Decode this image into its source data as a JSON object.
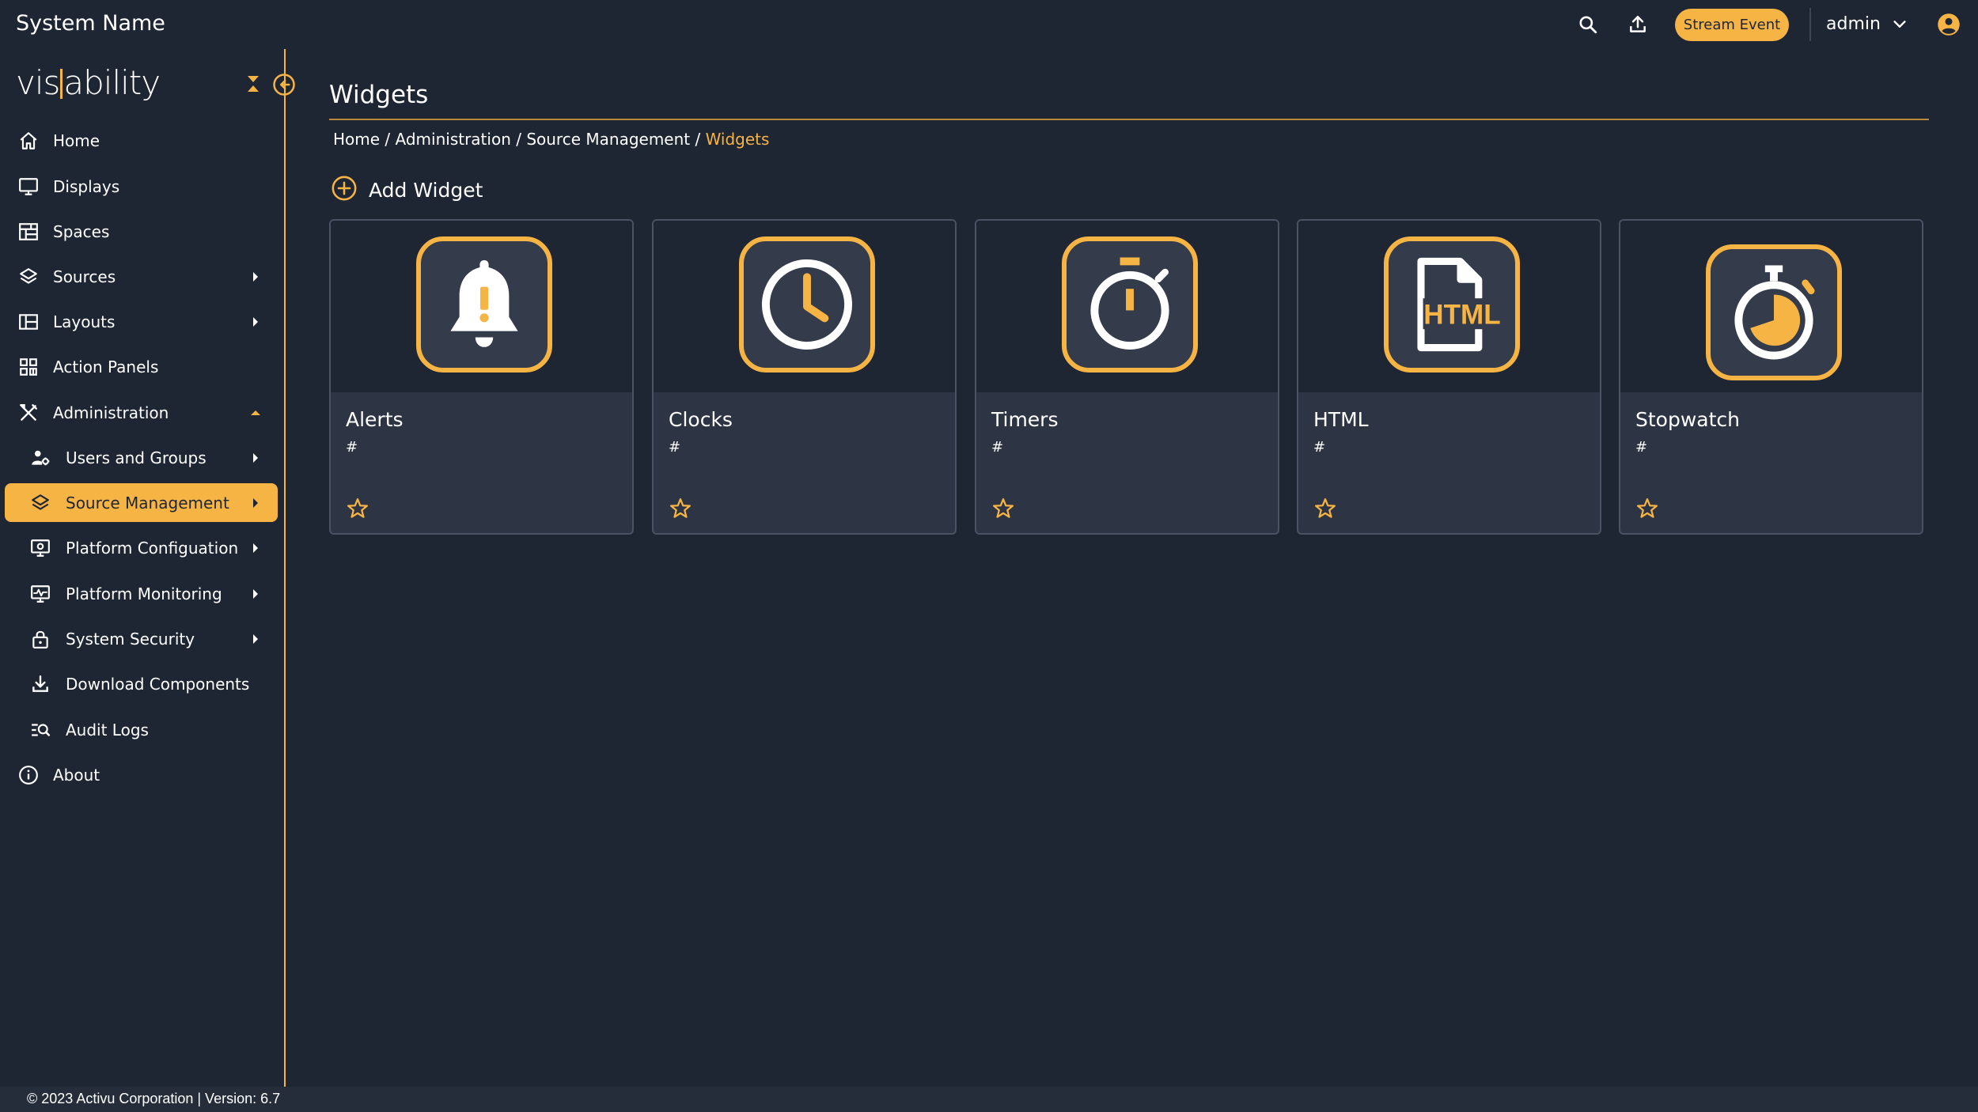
{
  "header": {
    "app_title": "System Name",
    "stream_event_label": "Stream Event",
    "user_name": "admin",
    "icons": [
      "search-icon",
      "upload-icon",
      "chevron-down-icon",
      "account-icon"
    ]
  },
  "logo": {
    "left": "vis",
    "right": "ability"
  },
  "sidebar": {
    "items": [
      {
        "label": "Home",
        "icon": "home-icon"
      },
      {
        "label": "Displays",
        "icon": "monitor-icon"
      },
      {
        "label": "Spaces",
        "icon": "spaces-icon"
      },
      {
        "label": "Sources",
        "icon": "layers-icon"
      },
      {
        "label": "Layouts",
        "icon": "layout-icon"
      },
      {
        "label": "Action Panels",
        "icon": "grid-icon"
      },
      {
        "label": "Administration",
        "icon": "tools-icon"
      },
      {
        "label": "Users and Groups",
        "icon": "users-gear-icon"
      },
      {
        "label": "Source Management",
        "icon": "layers-icon"
      },
      {
        "label": "Platform Configuation",
        "icon": "monitor-gear-icon"
      },
      {
        "label": "Platform Monitoring",
        "icon": "monitor-pulse-icon"
      },
      {
        "label": "System Security",
        "icon": "lock-icon"
      },
      {
        "label": "Download Components",
        "icon": "download-icon"
      },
      {
        "label": "Audit Logs",
        "icon": "audit-search-icon"
      },
      {
        "label": "About",
        "icon": "info-icon"
      }
    ],
    "active_item": "Source Management"
  },
  "footer": {
    "text": "© 2023 Activu Corporation  |  Version: 6.7"
  },
  "main": {
    "title": "Widgets",
    "breadcrumb": [
      {
        "label": "Home"
      },
      {
        "label": "Administration"
      },
      {
        "label": "Source Management"
      },
      {
        "label": "Widgets"
      }
    ],
    "breadcrumb_separator": " / ",
    "add_widget_label": "Add Widget",
    "widgets": [
      {
        "name": "Alerts",
        "sub": "#",
        "icon": "alert-bell-icon"
      },
      {
        "name": "Clocks",
        "sub": "#",
        "icon": "clock-icon"
      },
      {
        "name": "Timers",
        "sub": "#",
        "icon": "timer-icon"
      },
      {
        "name": "HTML",
        "sub": "#",
        "icon": "html-file-icon"
      },
      {
        "name": "Stopwatch",
        "sub": "#",
        "icon": "stopwatch-icon"
      }
    ]
  },
  "colors": {
    "background": "#1e2533",
    "accent": "#f6b445",
    "card": "#2d3443",
    "card_border": "#4a5264"
  }
}
